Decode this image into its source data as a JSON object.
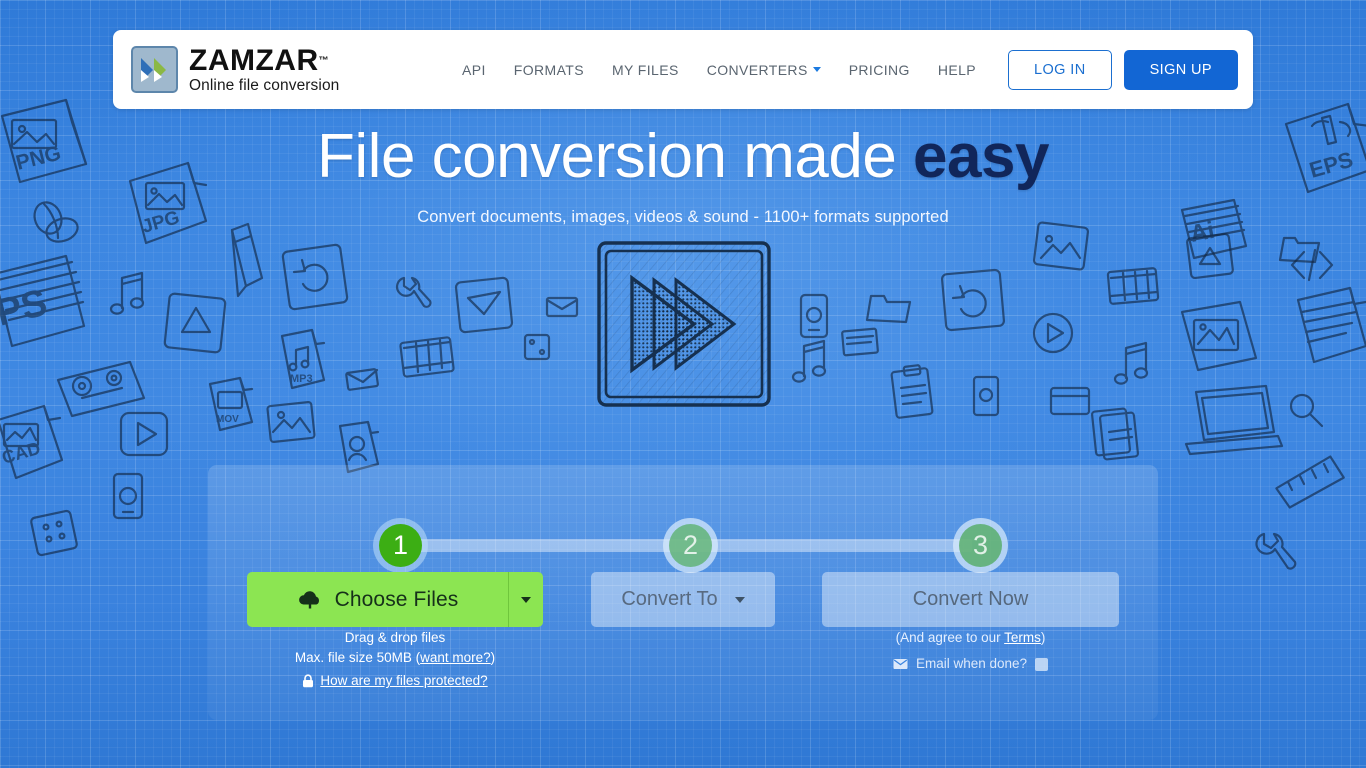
{
  "brand": {
    "name": "ZAMZAR",
    "trademark": "™",
    "tagline": "Online file conversion",
    "logo_icon": "double-chevron-icon",
    "colors": {
      "background_blue": "#3b85e0",
      "accent_blue": "#1266d4",
      "link_blue": "#1b6fd0",
      "choose_green": "#8ce552",
      "step_active_green": "#3cae14",
      "headline_accent_navy": "#11265a"
    }
  },
  "nav": {
    "items": [
      {
        "label": "API",
        "has_caret": false
      },
      {
        "label": "FORMATS",
        "has_caret": false
      },
      {
        "label": "MY FILES",
        "has_caret": false
      },
      {
        "label": "CONVERTERS",
        "has_caret": true
      },
      {
        "label": "PRICING",
        "has_caret": false
      },
      {
        "label": "HELP",
        "has_caret": false
      }
    ],
    "login_label": "LOG IN",
    "signup_label": "SIGN UP"
  },
  "hero": {
    "headline_main": "File conversion made ",
    "headline_accent": "easy",
    "subheadline": "Convert documents, images, videos & sound - 1100+ formats supported",
    "art_icon": "sketch-fast-forward-icon"
  },
  "converter": {
    "steps": [
      {
        "number": "1",
        "state": "active"
      },
      {
        "number": "2",
        "state": "inactive"
      },
      {
        "number": "3",
        "state": "inactive"
      }
    ],
    "choose_files": {
      "label": "Choose Files",
      "icon": "cloud-upload-icon",
      "caret_icon": "caret-down-icon"
    },
    "convert_to": {
      "label": "Convert To",
      "caret_icon": "caret-down-icon",
      "state": "disabled"
    },
    "convert_now": {
      "label": "Convert Now",
      "state": "disabled"
    },
    "left_notes": {
      "line1": "Drag & drop files",
      "line2_prefix": "Max. file size 50MB (",
      "line2_link": "want more?",
      "line2_suffix": ")",
      "protected_link": "How are my files protected?",
      "protected_icon": "lock-icon"
    },
    "right_notes": {
      "terms_prefix": "(And agree to our ",
      "terms_link": "Terms",
      "terms_suffix": ")",
      "email_icon": "envelope-icon",
      "email_label": "Email when done?",
      "email_checked": false
    }
  },
  "background": {
    "doodle_labels": [
      "PNG",
      "JPG",
      "PS",
      "CAD",
      "EPS",
      "Ai"
    ]
  }
}
